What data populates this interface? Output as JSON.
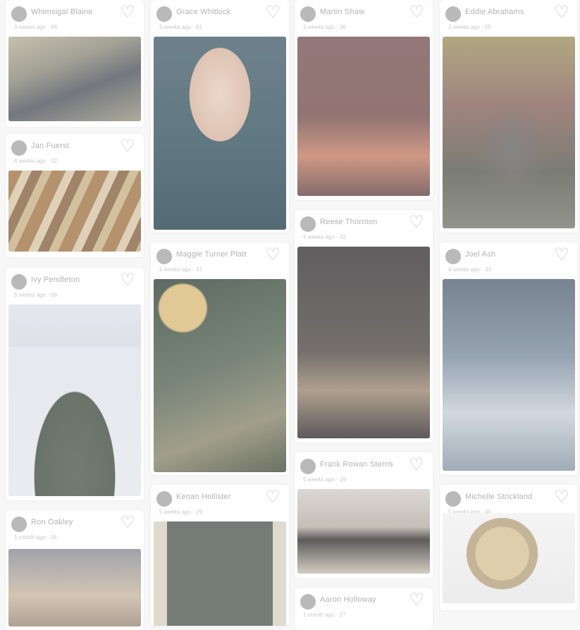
{
  "feed": {
    "columns": [
      [
        {
          "user": "Whimsigal Blaine",
          "meta": "3 weeks ago · 48",
          "image_name": "photo-dog"
        },
        {
          "user": "Jan Fuerst",
          "meta": "4 weeks ago · 32",
          "image_name": "photo-wood"
        },
        {
          "user": "Ivy Pendleton",
          "meta": "5 weeks ago · 58",
          "image_name": "photo-tree"
        },
        {
          "user": "Ron Oakley",
          "meta": "1 month ago · 24",
          "image_name": "photo-store"
        }
      ],
      [
        {
          "user": "Grace Whitlock",
          "meta": "3 weeks ago · 61",
          "image_name": "photo-woman"
        },
        {
          "user": "Maggie Turner Platt",
          "meta": "4 weeks ago · 47",
          "image_name": "photo-ornament"
        },
        {
          "user": "Kenan Hollister",
          "meta": "5 weeks ago · 29",
          "image_name": "photo-door"
        }
      ],
      [
        {
          "user": "Martin Shaw",
          "meta": "3 weeks ago · 36",
          "image_name": "photo-red-building"
        },
        {
          "user": "Reese Thornton",
          "meta": "4 weeks ago · 42",
          "image_name": "photo-night-scene"
        },
        {
          "user": "Frank Rowan Sterns",
          "meta": "5 weeks ago · 19",
          "image_name": "photo-couple"
        },
        {
          "user": "Aaron Holloway",
          "meta": "1 month ago · 27",
          "image_name": "photo-small"
        }
      ],
      [
        {
          "user": "Eddie Abrahams",
          "meta": "3 weeks ago · 55",
          "image_name": "photo-cat"
        },
        {
          "user": "Joel Ash",
          "meta": "4 weeks ago · 33",
          "image_name": "photo-rock"
        },
        {
          "user": "Michelle Strickland",
          "meta": "5 weeks ago · 40",
          "image_name": "photo-watch"
        }
      ]
    ]
  }
}
